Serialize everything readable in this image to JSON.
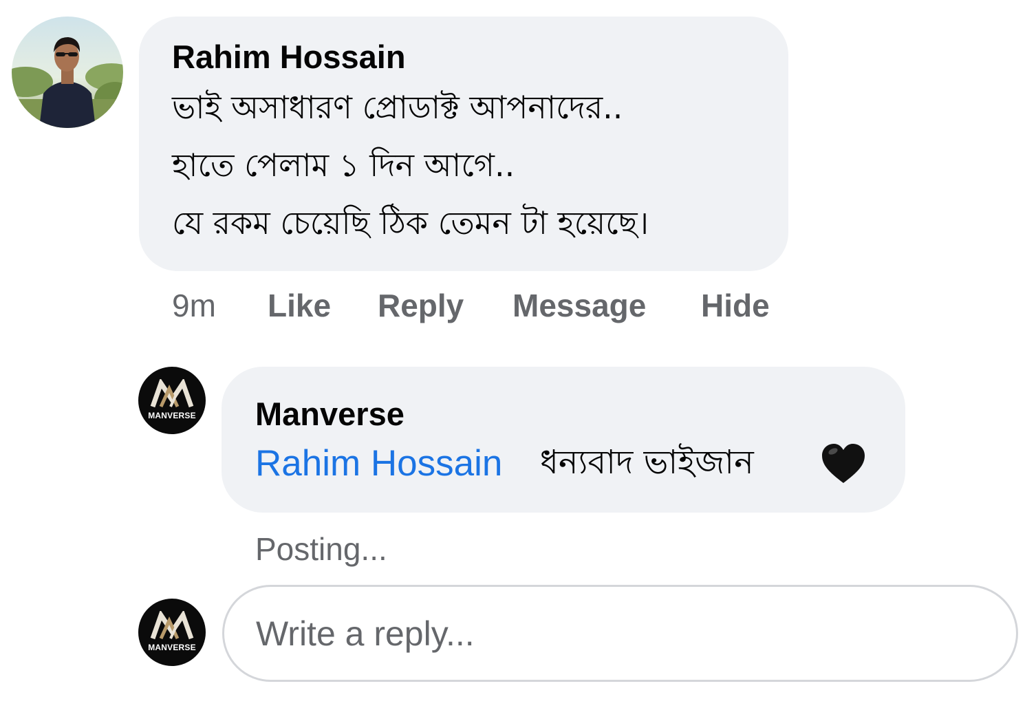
{
  "comment": {
    "author": "Rahim Hossain",
    "avatar_icon": "profile-photo",
    "lines": [
      "ভাই অসাধারণ  প্রোডাক্ট আপনাদের..",
      "হাতে পেলাম ১ দিন আগে..",
      "যে রকম চেয়েছি ঠিক  তেমন টা হয়েছে।"
    ],
    "time": "9m",
    "actions": {
      "like": "Like",
      "reply": "Reply",
      "message": "Message",
      "hide": "Hide"
    }
  },
  "reply": {
    "author": "Manverse",
    "brand_label": "MANVERSE",
    "mention": "Rahim Hossain",
    "text": "ধন্যবাদ ভাইজান",
    "emoji_icon": "black-heart-icon",
    "status": "Posting..."
  },
  "composer": {
    "placeholder": "Write a reply...",
    "brand_label": "MANVERSE"
  },
  "colors": {
    "bubble": "#f0f2f5",
    "mention": "#1b74e4",
    "secondary_text": "#65676b"
  }
}
